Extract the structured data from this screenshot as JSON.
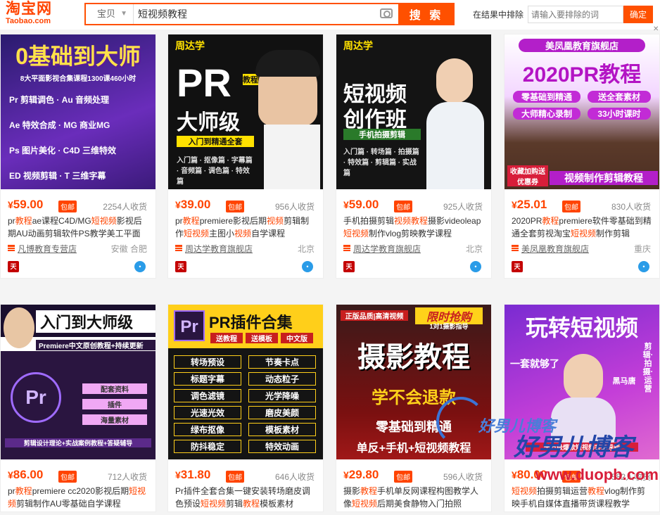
{
  "logo": {
    "cn": "淘宝网",
    "en": "Taobao.com"
  },
  "search": {
    "scope": "宝贝",
    "query": "短视频教程",
    "button": "搜 索"
  },
  "exclude": {
    "label": "在结果中排除",
    "placeholder": "请输入要排除的词",
    "confirm": "确定"
  },
  "colors": {
    "accent": "#ff5000",
    "price": "#ff4400",
    "tmall": "#c40000",
    "wangwang": "#2a9ce8"
  },
  "products": [
    {
      "image_text": [
        "0基础到大师",
        "8大平面影视合集课程1300课460小时",
        "Pr 剪辑调色 · Au 音频处理",
        "Ae 特效合成 · MG 商业MG",
        "Ps 图片美化 · C4D 三维特效",
        "ED 视频剪辑 · T 三维字幕"
      ],
      "price": "59.00",
      "currency": "¥",
      "free_ship": "包邮",
      "sales": "2254人收货",
      "title_parts": [
        [
          "pr",
          "n"
        ],
        [
          "教程",
          "h"
        ],
        [
          "ae课程C4D/MG",
          "n"
        ],
        [
          "短视频",
          "h"
        ],
        [
          "影视后期AU动画剪辑软件PS教学美工平面",
          "n"
        ]
      ],
      "shop": "凡博教育专营店",
      "location": "安徽 合肥"
    },
    {
      "image_text": [
        "周达学",
        "PR",
        "教程",
        "大师级",
        "入门到精通全套",
        "入门篇 · 抠像篇 · 字幕篇 · 音频篇 · 调色篇 · 特效篇"
      ],
      "price": "39.00",
      "currency": "¥",
      "free_ship": "包邮",
      "sales": "956人收货",
      "title_parts": [
        [
          "pr",
          "n"
        ],
        [
          "教程",
          "h"
        ],
        [
          "premiere影视后期",
          "n"
        ],
        [
          "视频",
          "h"
        ],
        [
          "剪辑制作",
          "n"
        ],
        [
          "短视频",
          "h"
        ],
        [
          "主图小",
          "n"
        ],
        [
          "视频",
          "h"
        ],
        [
          "自学课程",
          "n"
        ]
      ],
      "shop": "周达学教育旗舰店",
      "location": "北京"
    },
    {
      "image_text": [
        "周达学",
        "短视频",
        "创作班",
        "手机拍摄剪辑",
        "入门篇 · 转场篇 · 拍摄篇 · 特效篇 · 剪辑篇 · 实战篇"
      ],
      "price": "59.00",
      "currency": "¥",
      "free_ship": "包邮",
      "sales": "925人收货",
      "title_parts": [
        [
          "手机拍摄剪辑",
          "n"
        ],
        [
          "视频教程",
          "h"
        ],
        [
          "摄影videoleap",
          "n"
        ],
        [
          "短视频",
          "h"
        ],
        [
          "制作vlog剪映教学课程",
          "n"
        ]
      ],
      "shop": "周达学教育旗舰店",
      "location": "北京"
    },
    {
      "image_text": [
        "美凤凰教育旗舰店",
        "2020PR教程",
        "零基础到精通",
        "送全套素材",
        "大师精心录制",
        "33小时课时",
        "视频制作剪辑教程",
        "收藏加购送优惠券"
      ],
      "price": "25.01",
      "currency": "¥",
      "free_ship": "包邮",
      "sales": "830人收货",
      "title_parts": [
        [
          "2020PR",
          "n"
        ],
        [
          "教程",
          "h"
        ],
        [
          "premiere软件零基础到精通全套剪视淘宝",
          "n"
        ],
        [
          "短视频",
          "h"
        ],
        [
          "制作剪辑",
          "n"
        ]
      ],
      "shop": "美凤凰教育旗舰店",
      "location": "重庆"
    },
    {
      "image_text": [
        "入门到大师级",
        "Premiere中文原创教程+持续更新",
        "Pr",
        "配套资料",
        "插件",
        "海量素材",
        "剪辑设计理论+实战案例教程+答疑辅导"
      ],
      "price": "86.00",
      "currency": "¥",
      "free_ship": "包邮",
      "sales": "712人收货",
      "title_parts": [
        [
          "pr",
          "n"
        ],
        [
          "教程",
          "h"
        ],
        [
          "premiere cc2020影视后期",
          "n"
        ],
        [
          "短视频",
          "h"
        ],
        [
          "剪辑制作AU零基础自学课程",
          "n"
        ]
      ],
      "shop": "",
      "location": ""
    },
    {
      "image_text": [
        "Pr",
        "PR插件合集",
        "送教程",
        "送模板",
        "中文版",
        "转场预设",
        "节奏卡点",
        "标题字幕",
        "动态粒子",
        "调色滤镜",
        "光学降噪",
        "光速光效",
        "磨皮美颜",
        "绿布抠像",
        "模板素材",
        "防抖稳定",
        "特效动画"
      ],
      "price": "31.80",
      "currency": "¥",
      "free_ship": "包邮",
      "sales": "646人收货",
      "title_parts": [
        [
          "Pr插件全套合集一键安装转场磨皮调色预设",
          "n"
        ],
        [
          "短视频",
          "h"
        ],
        [
          "剪辑",
          "n"
        ],
        [
          "教程",
          "h"
        ],
        [
          "模板素材",
          "n"
        ]
      ],
      "shop": "",
      "location": ""
    },
    {
      "image_text": [
        "正版品质|高清视频",
        "限时抢购",
        "1对1摄影指导",
        "摄影教程",
        "学不会退款",
        "零基础到精通",
        "单反+手机+短视频教程"
      ],
      "price": "29.80",
      "currency": "¥",
      "free_ship": "包邮",
      "sales": "596人收货",
      "title_parts": [
        [
          "摄影",
          "n"
        ],
        [
          "教程",
          "h"
        ],
        [
          "手机单反网课程构图教学人像",
          "n"
        ],
        [
          "短视频",
          "h"
        ],
        [
          "后期美食静物入门拍照",
          "n"
        ]
      ],
      "shop": "",
      "location": ""
    },
    {
      "image_text": [
        "玩转短视频",
        "一套就够了",
        "黑马唐",
        "剪辑·拍摄·运营",
        "千万级爆款短视频实操导师"
      ],
      "price": "80.00",
      "currency": "¥",
      "free_ship": "包邮",
      "sales": "582人收货",
      "title_parts": [
        [
          "短视频",
          "h"
        ],
        [
          "拍摄剪辑运营",
          "n"
        ],
        [
          "教程",
          "h"
        ],
        [
          "vlog制作剪映手机自媒体直播带货课程教学",
          "n"
        ]
      ],
      "shop": "",
      "location": ""
    }
  ],
  "watermark": {
    "cn": "好男儿博客",
    "url": "www.duopb.com",
    "script": "好男儿博客"
  }
}
